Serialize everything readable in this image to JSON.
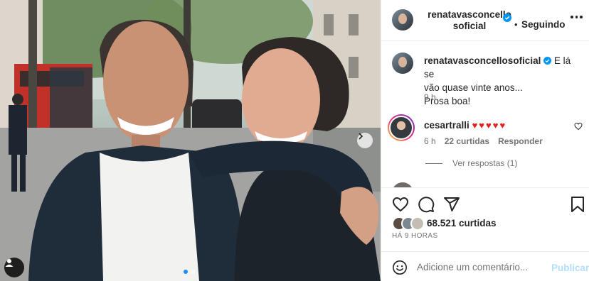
{
  "post": {
    "username": "renatavasconcellosoficial",
    "username_line1": "renatavasconcello",
    "username_line2": "soficial",
    "follow_status": "Seguindo",
    "caption_user": "renatavasconcellosoficial",
    "caption_text": "E lá se vão quase vinte anos... Prosa boa!",
    "caption_line1": "E lá se",
    "caption_line2": "vão quase vinte anos...",
    "caption_line3": "Prosa boa!",
    "caption_time": "9 h",
    "likes": "68.521 curtidas",
    "time_ago": "HÁ 9 HORAS"
  },
  "comments": [
    {
      "username": "cesartralli",
      "text": "♥♥♥♥♥",
      "time": "6 h",
      "likes": "22 curtidas",
      "reply_label": "Responder",
      "replies_label": "Ver respostas (1)"
    }
  ],
  "comment_bar": {
    "placeholder": "Adicione um comentário...",
    "post_label": "Publicar"
  },
  "carousel": {
    "index": 1,
    "count": 2
  },
  "icons": [
    "verified-badge-icon",
    "more-options-icon",
    "heart-icon",
    "comment-icon",
    "share-icon",
    "bookmark-icon",
    "emoji-icon",
    "tag-people-icon",
    "next-arrow-icon"
  ],
  "colors": {
    "verified": "#0095f6",
    "heart": "#e0241a",
    "publish_disabled": "#b2dffc",
    "muted_text": "#737373"
  }
}
